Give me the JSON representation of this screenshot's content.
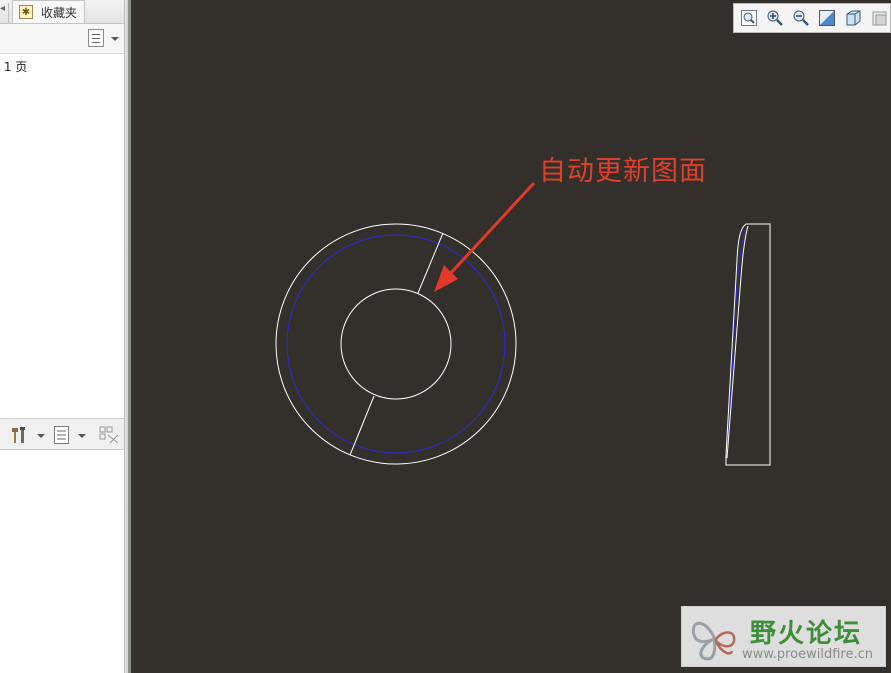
{
  "left_panel": {
    "tabs": [
      {
        "label": "收藏夹",
        "icon": "star-icon"
      }
    ],
    "page_indicator": "第 1 页",
    "toolbar1": {
      "button_icon": "list-view-icon"
    },
    "toolbar2": {
      "icons": [
        "tools-icon",
        "list-view-icon",
        "filter-icon"
      ]
    }
  },
  "view_toolbar": {
    "buttons": [
      "zoom-fit-icon",
      "zoom-in-icon",
      "zoom-out-icon",
      "repaint-icon",
      "view-orientation-icon",
      "saved-views-icon"
    ]
  },
  "annotation": {
    "text": "自动更新图面",
    "color": "#e0402b"
  },
  "drawing": {
    "background": "#33302b",
    "line_color": "#ffffff",
    "hidden_line_color": "#2b2bdc"
  },
  "watermark": {
    "title": "野火论坛",
    "url": "www.proewildfire.cn"
  }
}
